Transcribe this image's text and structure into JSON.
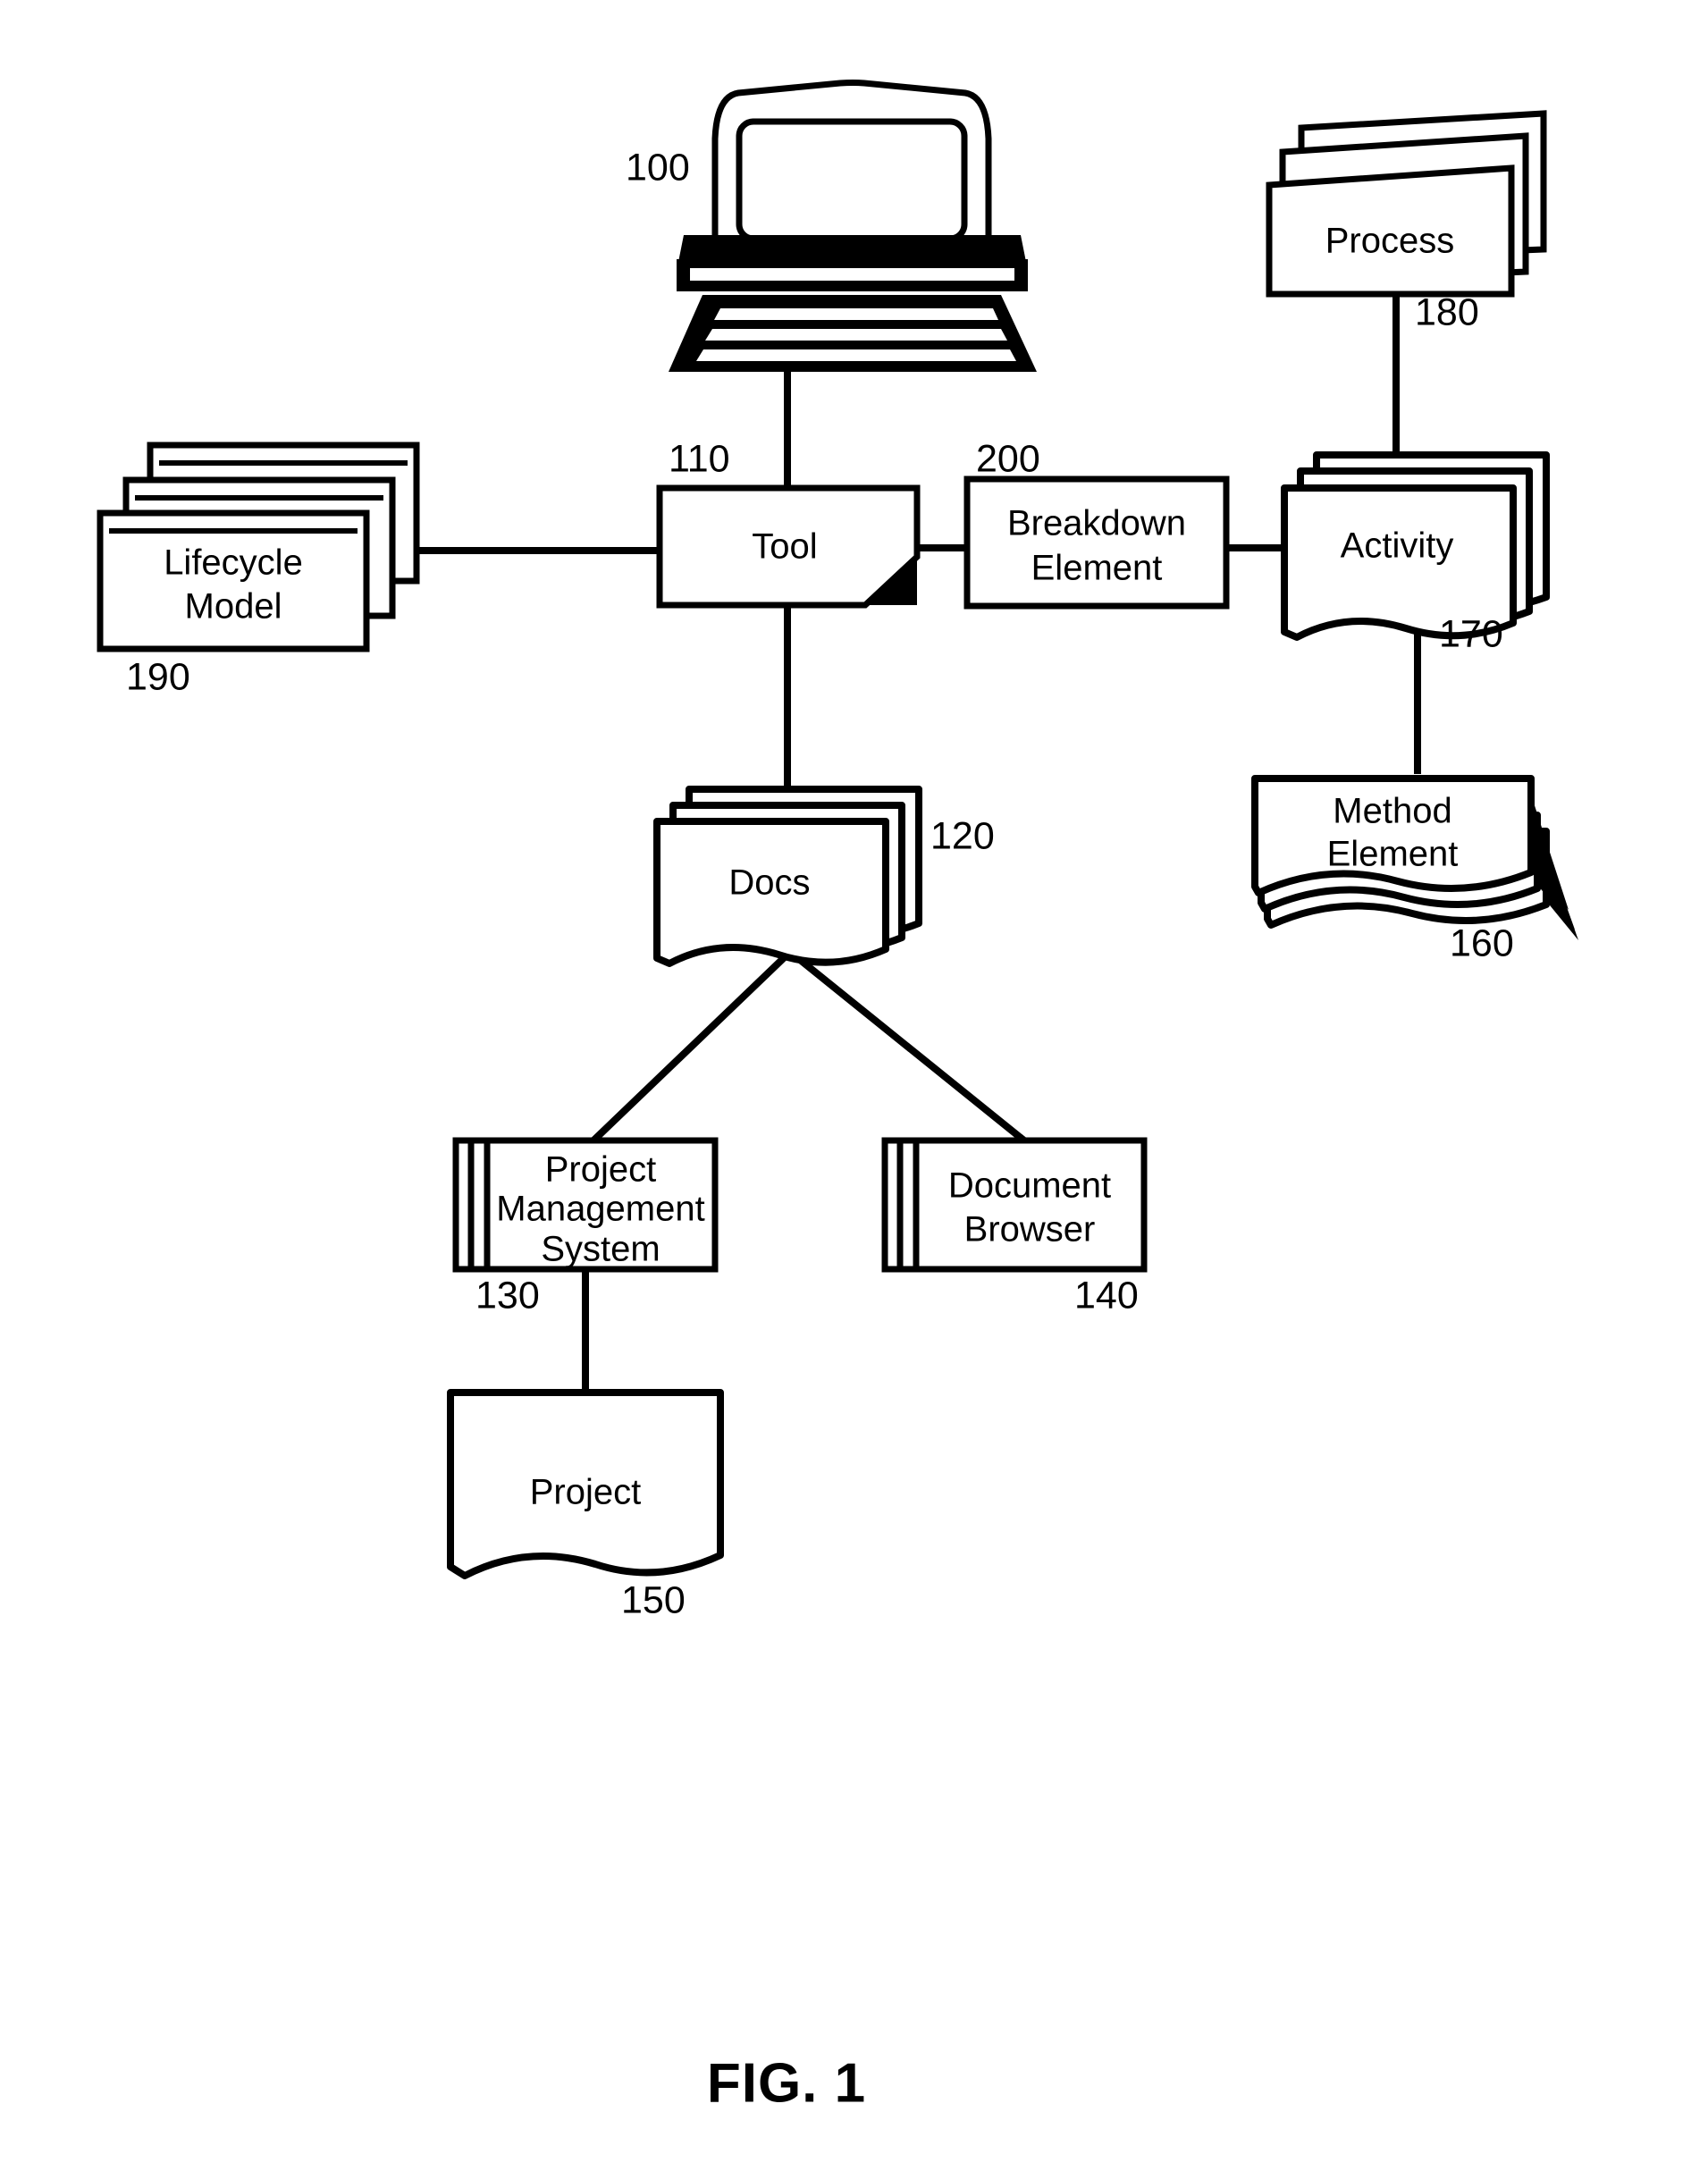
{
  "figure": {
    "caption": "FIG. 1",
    "type": "patent-block-diagram"
  },
  "nodes": {
    "computer": {
      "label": "",
      "ref": "100",
      "icon": "desktop-computer-icon"
    },
    "tool": {
      "label": "Tool",
      "ref": "110"
    },
    "docs": {
      "label": "Docs",
      "ref": "120"
    },
    "pms": {
      "label_line1": "Project",
      "label_line2": "Management",
      "label_line3": "System",
      "ref": "130"
    },
    "doc_browser": {
      "label_line1": "Document",
      "label_line2": "Browser",
      "ref": "140"
    },
    "project": {
      "label": "Project",
      "ref": "150"
    },
    "method_element": {
      "label_line1": "Method",
      "label_line2": "Element",
      "ref": "160"
    },
    "activity": {
      "label": "Activity",
      "ref": "170"
    },
    "process": {
      "label": "Process",
      "ref": "180"
    },
    "lifecycle_model": {
      "label_line1": "Lifecycle",
      "label_line2": "Model",
      "ref": "190"
    },
    "breakdown_element": {
      "label_line1": "Breakdown",
      "label_line2": "Element",
      "ref": "200"
    }
  },
  "colors": {
    "ink": "#000000",
    "paper": "#ffffff"
  }
}
